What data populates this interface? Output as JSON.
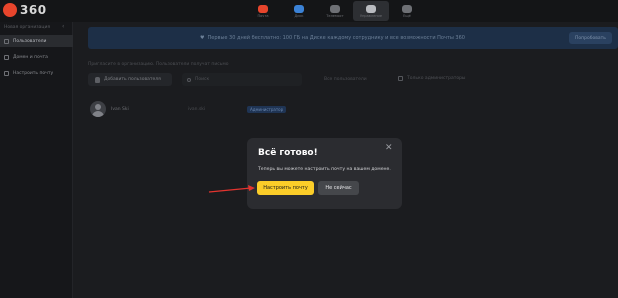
{
  "app": {
    "logo_text": "360"
  },
  "topnav": [
    {
      "label": "Почта",
      "icon": "mail-icon",
      "color": "#e8452c",
      "active": false
    },
    {
      "label": "Диск",
      "icon": "disk-icon",
      "color": "#3b82d6",
      "active": false
    },
    {
      "label": "Телемост",
      "icon": "telemost-icon",
      "color": "#6e7075",
      "active": false
    },
    {
      "label": "Управление",
      "icon": "people-icon",
      "color": "#b9bbc0",
      "active": true
    },
    {
      "label": "Ещё",
      "icon": "grid-icon",
      "color": "#6e7075",
      "active": false
    }
  ],
  "sidebar": {
    "org_name": "Новая организация",
    "items": [
      {
        "label": "Пользователи",
        "icon": "people-icon",
        "active": true
      },
      {
        "label": "Домен и почта",
        "icon": "globe-icon",
        "active": false
      },
      {
        "label": "Настроить почту",
        "icon": "mail-icon",
        "active": false
      }
    ]
  },
  "banner": {
    "text": "Первые 30 дней бесплатно: 100 ГБ на Диске каждому сотруднику и все возможности Почты 360",
    "button": "Попробовать"
  },
  "main": {
    "hint": "Пригласите в организацию. Пользователи получат письмо",
    "add_button": "Добавить пользователя",
    "search_placeholder": "Поиск",
    "filter_label": "Все пользователи",
    "filter_check": "Только администраторы"
  },
  "table": {
    "rows": [
      {
        "name": "Ivan Ski",
        "login": "ivan.ski",
        "badge": "Администратор"
      }
    ]
  },
  "modal": {
    "title": "Всё готово!",
    "text": "Теперь вы можете настроить почту на вашем домене.",
    "primary_button": "Настроить почту",
    "secondary_button": "Не сейчас",
    "close_icon": "close-icon"
  },
  "colors": {
    "accent": "#fbcd29",
    "annotation_arrow": "#e3342f"
  }
}
